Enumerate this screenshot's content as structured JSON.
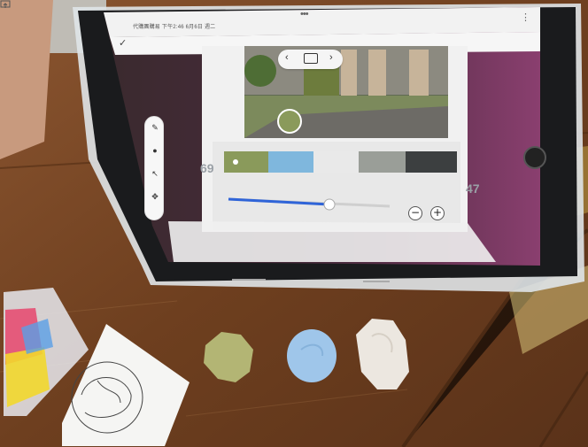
{
  "status_bar": {
    "time_text": "下午2:46 6月6日 週二",
    "app_name": "代購團購易"
  },
  "toolbar": {
    "icons": [
      "pen-icon",
      "fill-icon",
      "select-icon",
      "move-icon"
    ]
  },
  "navigator": {
    "prev_label": "‹",
    "next_label": "›"
  },
  "palette": {
    "swatches": [
      "#8a9a5b",
      "#7fb7dd",
      "#e9e9e9",
      "#9a9e98",
      "#3c3f40"
    ]
  },
  "side_numbers": {
    "left": "69",
    "right": "47"
  },
  "zoom": {
    "minus_label": "−",
    "plus_label": "+",
    "level": 0.5
  },
  "clay_colors": {
    "green": "#b3b574",
    "blue": "#9fc6ea",
    "white": "#ece7e0"
  }
}
